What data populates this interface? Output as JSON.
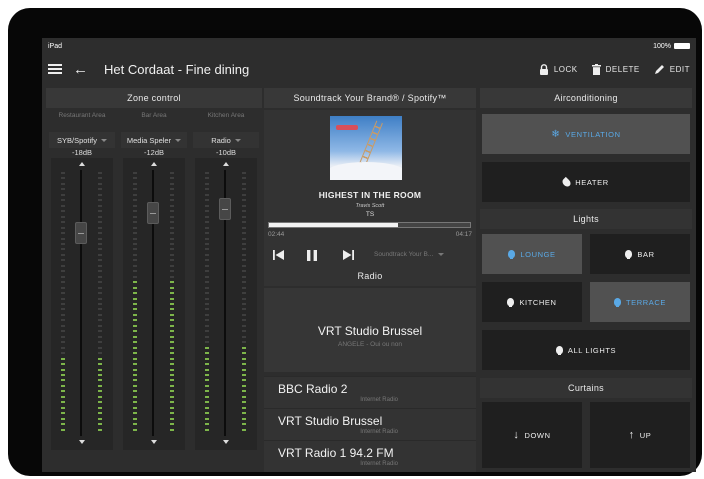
{
  "status": {
    "device": "iPad",
    "battery": "100%"
  },
  "header": {
    "title": "Het Cordaat - Fine dining",
    "lock": "LOCK",
    "delete": "DELETE",
    "edit": "EDIT"
  },
  "zone_control": {
    "title": "Zone control",
    "zones": [
      {
        "area": "Restaurant Area",
        "source": "SYB/Spotify",
        "level": "-18dB",
        "meter_fraction": 0.3
      },
      {
        "area": "Bar Area",
        "source": "Media Speler",
        "level": "-12dB",
        "meter_fraction": 0.58
      },
      {
        "area": "Kitchen Area",
        "source": "Radio",
        "level": "-10dB",
        "meter_fraction": 0.33
      }
    ]
  },
  "player": {
    "title": "Soundtrack Your Brand® / Spotify™",
    "track": "HIGHEST IN THE ROOM",
    "artist": "Travis Scott",
    "album_text": "TS",
    "elapsed": "02:44",
    "duration": "04:17",
    "progress": 0.64,
    "source": "Soundtrack Your B..."
  },
  "radio": {
    "title": "Radio",
    "now_playing": {
      "station": "VRT Studio Brussel",
      "song": "ANGELE - Oui ou non"
    },
    "stations": [
      {
        "name": "BBC Radio 2",
        "type": "Internet Radio"
      },
      {
        "name": "VRT Studio Brussel",
        "type": "Internet Radio"
      },
      {
        "name": "VRT Radio 1 94.2 FM",
        "type": "Internet Radio"
      }
    ]
  },
  "airco": {
    "title": "Airconditioning",
    "ventilation": "VENTILATION",
    "heater": "HEATER"
  },
  "lights": {
    "title": "Lights",
    "lounge": "LOUNGE",
    "bar": "BAR",
    "kitchen": "KITCHEN",
    "terrace": "TERRACE",
    "all": "ALL LIGHTS"
  },
  "curtains": {
    "title": "Curtains",
    "down": "DOWN",
    "up": "UP"
  },
  "colors": {
    "background": "#2d2d2d",
    "active_accent": "#5aa9e6",
    "meter_green": "#7db54a"
  }
}
